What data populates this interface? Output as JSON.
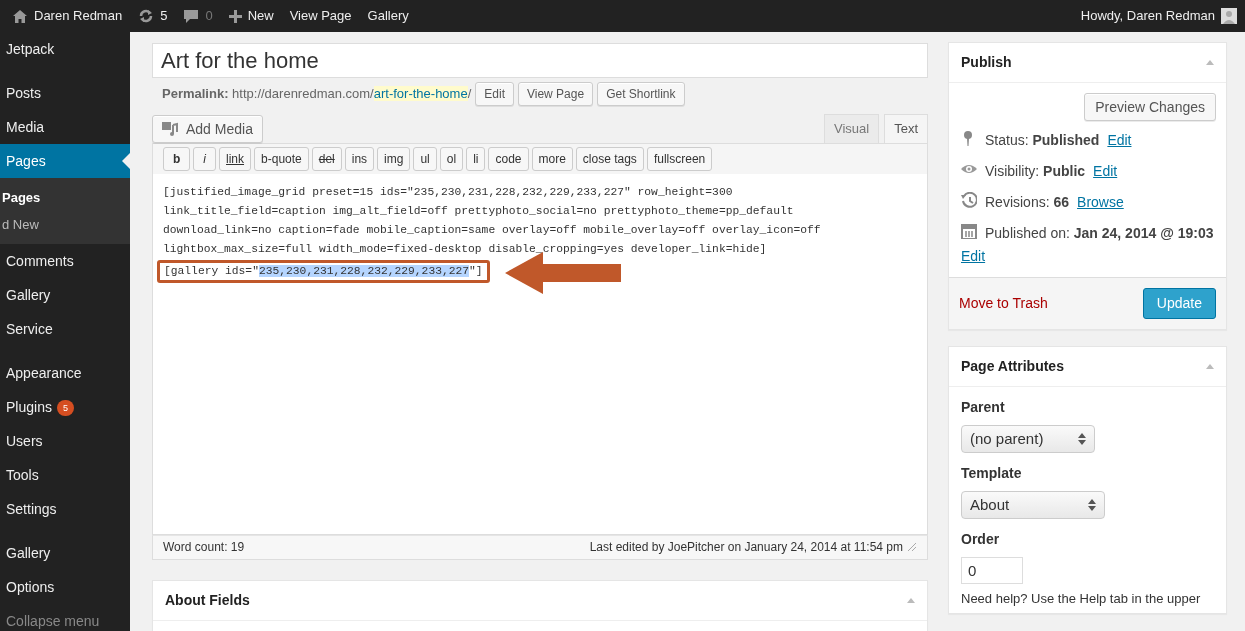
{
  "admin_bar": {
    "site": "Daren Redman",
    "updates": "5",
    "comments": "0",
    "new": "New",
    "links": [
      "View Page",
      "Gallery"
    ],
    "greeting": "Howdy, Daren Redman"
  },
  "sidebar": {
    "groups": [
      [
        {
          "label": "Jetpack",
          "selected": false
        }
      ],
      [
        {
          "label": "Posts",
          "selected": false
        },
        {
          "label": "Media",
          "selected": false
        },
        {
          "label": "Pages",
          "selected": true,
          "children": [
            {
              "label": "Pages",
              "selected": true
            },
            {
              "label": "d New",
              "selected": false
            }
          ]
        },
        {
          "label": "Comments",
          "selected": false
        },
        {
          "label": "Gallery",
          "selected": false
        },
        {
          "label": "Service",
          "selected": false
        }
      ],
      [
        {
          "label": "Appearance",
          "selected": false
        },
        {
          "label": "Plugins",
          "selected": false,
          "badge": "5"
        },
        {
          "label": "Users",
          "selected": false
        },
        {
          "label": "Tools",
          "selected": false
        },
        {
          "label": "Settings",
          "selected": false
        }
      ],
      [
        {
          "label": "Gallery",
          "selected": false
        },
        {
          "label": "Options",
          "selected": false
        }
      ]
    ],
    "collapse": "Collapse menu"
  },
  "editor": {
    "title": "Art for the home",
    "permalink": {
      "label": "Permalink:",
      "base": "http://darenredman.com/",
      "slug": "art-for-the-home",
      "trail": "/",
      "buttons": [
        "Edit",
        "View Page",
        "Get Shortlink"
      ]
    },
    "add_media": "Add Media",
    "tabs": [
      {
        "label": "Visual",
        "selected": false
      },
      {
        "label": "Text",
        "selected": true
      }
    ],
    "quicktags": [
      {
        "label": "b",
        "kind": "bold"
      },
      {
        "label": "i",
        "kind": "italic"
      },
      {
        "label": "link",
        "kind": "underline"
      },
      {
        "label": "b-quote",
        "kind": "plain"
      },
      {
        "label": "del",
        "kind": "strike"
      },
      {
        "label": "ins",
        "kind": "plain"
      },
      {
        "label": "img",
        "kind": "plain"
      },
      {
        "label": "ul",
        "kind": "plain"
      },
      {
        "label": "ol",
        "kind": "plain"
      },
      {
        "label": "li",
        "kind": "plain"
      },
      {
        "label": "code",
        "kind": "plain"
      },
      {
        "label": "more",
        "kind": "plain"
      },
      {
        "label": "close tags",
        "kind": "plain"
      },
      {
        "label": "fullscreen",
        "kind": "plain"
      }
    ],
    "lines": [
      {
        "kind": "plain",
        "text": "[justified_image_grid preset=15 ids=\"235,230,231,228,232,229,233,227\" row_height=300"
      },
      {
        "kind": "plain",
        "text": "link_title_field=caption img_alt_field=off prettyphoto_social=no prettyphoto_theme=pp_default"
      },
      {
        "kind": "plain",
        "text": "download_link=no caption=fade mobile_caption=same overlay=off mobile_overlay=off overlay_icon=off"
      },
      {
        "kind": "plain",
        "text": "lightbox_max_size=full width_mode=fixed-desktop disable_cropping=yes developer_link=hide]"
      },
      {
        "kind": "highlighted",
        "before": "[gallery ids=\"",
        "selection": "235,230,231,228,232,229,233,227",
        "after": "\"]"
      }
    ],
    "word_count": "Word count: 19",
    "last_edited": "Last edited by JoePitcher on January 24, 2014 at 11:54 pm"
  },
  "about_fields": {
    "title": "About Fields"
  },
  "publish": {
    "title": "Publish",
    "preview": "Preview Changes",
    "rows": [
      {
        "kind": "pin",
        "label": "Status:",
        "value": "Published",
        "link": "Edit"
      },
      {
        "kind": "eye",
        "label": "Visibility:",
        "value": "Public",
        "link": "Edit"
      },
      {
        "kind": "clock",
        "label": "Revisions:",
        "value": "66",
        "link": "Browse"
      },
      {
        "kind": "calendar",
        "label": "Published on:",
        "value": "Jan 24, 2014 @ 19:03",
        "link": "Edit"
      }
    ],
    "trash": "Move to Trash",
    "update": "Update"
  },
  "page_attributes": {
    "title": "Page Attributes",
    "parent_label": "Parent",
    "parent": "(no parent)",
    "template_label": "Template",
    "template": "About",
    "order_label": "Order",
    "order": "0",
    "help": "Need help? Use the Help tab in the upper"
  }
}
